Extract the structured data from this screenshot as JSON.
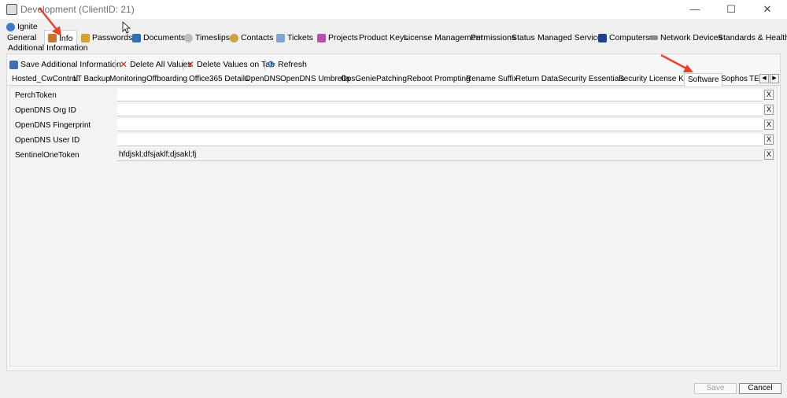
{
  "window": {
    "title": "Development   (ClientID: 21)",
    "minimize": "—",
    "maximize": "☐",
    "close": "✕"
  },
  "top_tabs": {
    "ignite": "Ignite",
    "general": "General",
    "info": "Info",
    "passwords": "Passwords",
    "documents": "Documents",
    "timeslips": "Timeslips",
    "contacts": "Contacts",
    "tickets": "Tickets",
    "projects": "Projects",
    "product_keys": "Product Keys",
    "license_management": "License Management",
    "permissions": "Permissions",
    "status": "Status",
    "managed_services": "Managed Services",
    "computers": "Computers",
    "network_devices": "Network Devices",
    "standards_health": "Standards & Health"
  },
  "subtab": "Additional Information",
  "toolbar": {
    "save": "Save Additional Information",
    "delete_all": "Delete All Values",
    "delete_tab": "Delete Values on Tab",
    "refresh": "Refresh"
  },
  "inner_tabs": [
    "Hosted_CwControl",
    "LT Backup",
    "Monitoring",
    "Offboarding",
    "Office365 Details",
    "OpenDNS",
    "OpenDNS Umbrella",
    "OpsGenie",
    "Patching",
    "Reboot Prompting",
    "Rename Suffix",
    "Return Data",
    "Security Essentials",
    "Security License Keys",
    "Software",
    "Sophos",
    "TES"
  ],
  "fields": [
    {
      "label": "PerchToken",
      "value": ""
    },
    {
      "label": "OpenDNS Org ID",
      "value": ""
    },
    {
      "label": "OpenDNS Fingerprint",
      "value": ""
    },
    {
      "label": "OpenDNS User ID",
      "value": ""
    },
    {
      "label": "SentinelOneToken",
      "value": "hfdjskl;dfsjaklf;djsakl;fj"
    }
  ],
  "clear_label": "X",
  "footer": {
    "save": "Save",
    "cancel": "Cancel"
  },
  "colors": {
    "highlight": "#f4f400",
    "arrow": "#e8412c"
  }
}
